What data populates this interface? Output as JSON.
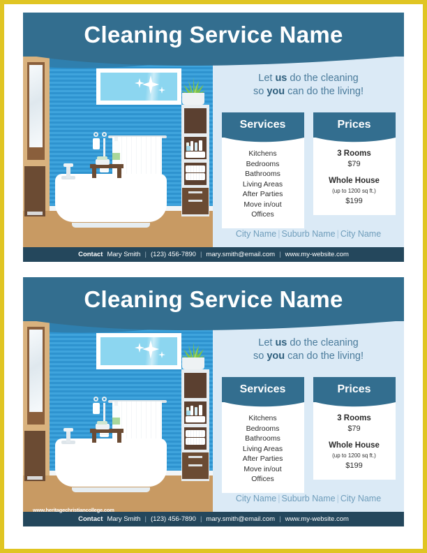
{
  "page": {
    "border_color": "#e0c523",
    "background": "#ffffff"
  },
  "colors": {
    "header_blue": "#336e8f",
    "contact_bar": "#24475c",
    "panel_bg": "#dbeaf6",
    "wall_blue": "#3fa4dd",
    "floor_tan": "#c89a63",
    "cabinet_brown": "#6b4b33",
    "city_text": "#6f9dbb",
    "tagline_text": "#4a7b9b"
  },
  "flyer": {
    "title": "Cleaning Service Name",
    "tagline": {
      "line1_pre": "Let ",
      "line1_bold": "us",
      "line1_post": " do the cleaning",
      "line2_pre": "so ",
      "line2_bold": "you",
      "line2_post": " can do the living!"
    },
    "services_card": {
      "heading": "Services",
      "items": [
        "Kitchens",
        "Bedrooms",
        "Bathrooms",
        "Living Areas",
        "After Parties",
        "Move in/out",
        "Offices"
      ]
    },
    "prices_card": {
      "heading": "Prices",
      "entries": [
        {
          "name": "3 Rooms",
          "note": "",
          "value": "$79"
        },
        {
          "name": "Whole House",
          "note": "(up to 1200 sq ft.)",
          "value": "$199"
        }
      ]
    },
    "cities": {
      "items": [
        "City Name",
        "Suburb Name",
        "City Name"
      ],
      "separator": "|"
    },
    "contact": {
      "label": "Contact",
      "name": "Mary Smith",
      "phone": "(123) 456-7890",
      "email": "mary.smith@email.com",
      "website": "www.my-website.com",
      "separator": "|"
    }
  },
  "watermark": {
    "text": "www.heritagechristiancollege.com"
  }
}
